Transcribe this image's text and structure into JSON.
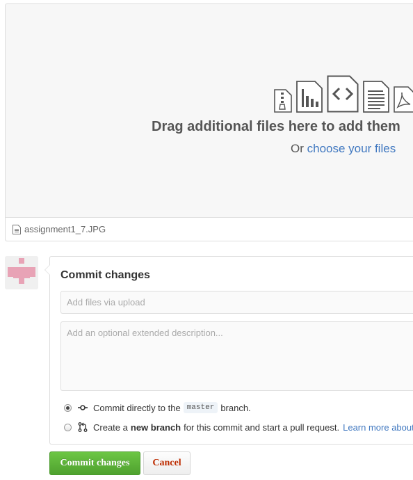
{
  "upload": {
    "icons": [
      "zip-file-icon",
      "chart-file-icon",
      "code-file-icon",
      "text-file-icon",
      "pdf-file-icon"
    ],
    "title": "Drag additional files here to add them",
    "sub_prefix": "Or",
    "sub_link": "choose your files",
    "file_name": "assignment1_7.JPG"
  },
  "commit": {
    "title": "Commit changes",
    "summary_placeholder": "Add files via upload",
    "description_placeholder": "Add an optional extended description...",
    "option_direct": {
      "prefix": "Commit directly to the",
      "branch": "master",
      "suffix": "branch.",
      "selected": true
    },
    "option_new_branch": {
      "prefix": "Create a",
      "bold": "new branch",
      "suffix": "for this commit and start a pull request.",
      "link": "Learn more about",
      "selected": false
    }
  },
  "buttons": {
    "commit": "Commit changes",
    "cancel": "Cancel"
  },
  "colors": {
    "accent_link": "#4078c0",
    "primary_button": "#6cc644",
    "cancel_text": "#bd2c00",
    "avatar_pink": "#e8a3b6"
  }
}
